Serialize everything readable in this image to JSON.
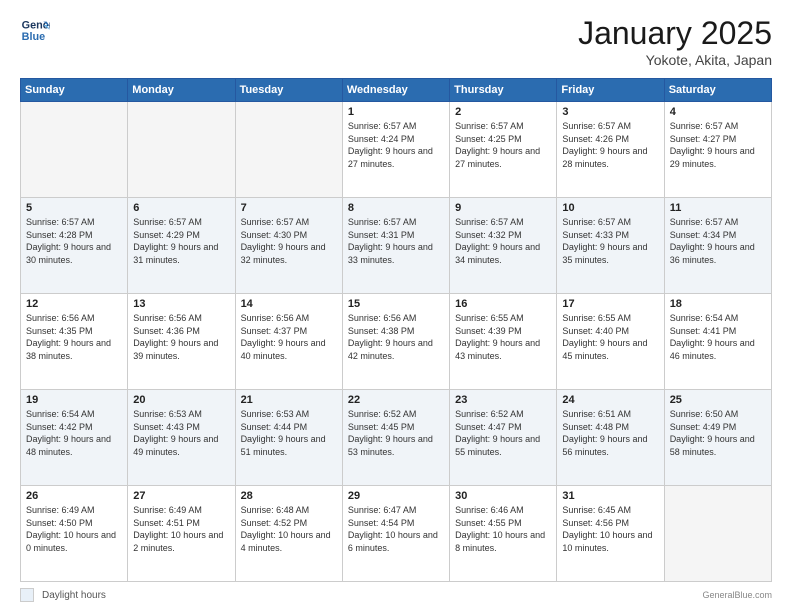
{
  "header": {
    "logo_line1": "General",
    "logo_line2": "Blue",
    "month": "January 2025",
    "location": "Yokote, Akita, Japan"
  },
  "days_of_week": [
    "Sunday",
    "Monday",
    "Tuesday",
    "Wednesday",
    "Thursday",
    "Friday",
    "Saturday"
  ],
  "weeks": [
    {
      "row_class": "row-white",
      "days": [
        {
          "num": "",
          "info": ""
        },
        {
          "num": "",
          "info": ""
        },
        {
          "num": "",
          "info": ""
        },
        {
          "num": "1",
          "info": "Sunrise: 6:57 AM\nSunset: 4:24 PM\nDaylight: 9 hours and 27 minutes."
        },
        {
          "num": "2",
          "info": "Sunrise: 6:57 AM\nSunset: 4:25 PM\nDaylight: 9 hours and 27 minutes."
        },
        {
          "num": "3",
          "info": "Sunrise: 6:57 AM\nSunset: 4:26 PM\nDaylight: 9 hours and 28 minutes."
        },
        {
          "num": "4",
          "info": "Sunrise: 6:57 AM\nSunset: 4:27 PM\nDaylight: 9 hours and 29 minutes."
        }
      ]
    },
    {
      "row_class": "row-blue",
      "days": [
        {
          "num": "5",
          "info": "Sunrise: 6:57 AM\nSunset: 4:28 PM\nDaylight: 9 hours and 30 minutes."
        },
        {
          "num": "6",
          "info": "Sunrise: 6:57 AM\nSunset: 4:29 PM\nDaylight: 9 hours and 31 minutes."
        },
        {
          "num": "7",
          "info": "Sunrise: 6:57 AM\nSunset: 4:30 PM\nDaylight: 9 hours and 32 minutes."
        },
        {
          "num": "8",
          "info": "Sunrise: 6:57 AM\nSunset: 4:31 PM\nDaylight: 9 hours and 33 minutes."
        },
        {
          "num": "9",
          "info": "Sunrise: 6:57 AM\nSunset: 4:32 PM\nDaylight: 9 hours and 34 minutes."
        },
        {
          "num": "10",
          "info": "Sunrise: 6:57 AM\nSunset: 4:33 PM\nDaylight: 9 hours and 35 minutes."
        },
        {
          "num": "11",
          "info": "Sunrise: 6:57 AM\nSunset: 4:34 PM\nDaylight: 9 hours and 36 minutes."
        }
      ]
    },
    {
      "row_class": "row-white",
      "days": [
        {
          "num": "12",
          "info": "Sunrise: 6:56 AM\nSunset: 4:35 PM\nDaylight: 9 hours and 38 minutes."
        },
        {
          "num": "13",
          "info": "Sunrise: 6:56 AM\nSunset: 4:36 PM\nDaylight: 9 hours and 39 minutes."
        },
        {
          "num": "14",
          "info": "Sunrise: 6:56 AM\nSunset: 4:37 PM\nDaylight: 9 hours and 40 minutes."
        },
        {
          "num": "15",
          "info": "Sunrise: 6:56 AM\nSunset: 4:38 PM\nDaylight: 9 hours and 42 minutes."
        },
        {
          "num": "16",
          "info": "Sunrise: 6:55 AM\nSunset: 4:39 PM\nDaylight: 9 hours and 43 minutes."
        },
        {
          "num": "17",
          "info": "Sunrise: 6:55 AM\nSunset: 4:40 PM\nDaylight: 9 hours and 45 minutes."
        },
        {
          "num": "18",
          "info": "Sunrise: 6:54 AM\nSunset: 4:41 PM\nDaylight: 9 hours and 46 minutes."
        }
      ]
    },
    {
      "row_class": "row-blue",
      "days": [
        {
          "num": "19",
          "info": "Sunrise: 6:54 AM\nSunset: 4:42 PM\nDaylight: 9 hours and 48 minutes."
        },
        {
          "num": "20",
          "info": "Sunrise: 6:53 AM\nSunset: 4:43 PM\nDaylight: 9 hours and 49 minutes."
        },
        {
          "num": "21",
          "info": "Sunrise: 6:53 AM\nSunset: 4:44 PM\nDaylight: 9 hours and 51 minutes."
        },
        {
          "num": "22",
          "info": "Sunrise: 6:52 AM\nSunset: 4:45 PM\nDaylight: 9 hours and 53 minutes."
        },
        {
          "num": "23",
          "info": "Sunrise: 6:52 AM\nSunset: 4:47 PM\nDaylight: 9 hours and 55 minutes."
        },
        {
          "num": "24",
          "info": "Sunrise: 6:51 AM\nSunset: 4:48 PM\nDaylight: 9 hours and 56 minutes."
        },
        {
          "num": "25",
          "info": "Sunrise: 6:50 AM\nSunset: 4:49 PM\nDaylight: 9 hours and 58 minutes."
        }
      ]
    },
    {
      "row_class": "row-white",
      "days": [
        {
          "num": "26",
          "info": "Sunrise: 6:49 AM\nSunset: 4:50 PM\nDaylight: 10 hours and 0 minutes."
        },
        {
          "num": "27",
          "info": "Sunrise: 6:49 AM\nSunset: 4:51 PM\nDaylight: 10 hours and 2 minutes."
        },
        {
          "num": "28",
          "info": "Sunrise: 6:48 AM\nSunset: 4:52 PM\nDaylight: 10 hours and 4 minutes."
        },
        {
          "num": "29",
          "info": "Sunrise: 6:47 AM\nSunset: 4:54 PM\nDaylight: 10 hours and 6 minutes."
        },
        {
          "num": "30",
          "info": "Sunrise: 6:46 AM\nSunset: 4:55 PM\nDaylight: 10 hours and 8 minutes."
        },
        {
          "num": "31",
          "info": "Sunrise: 6:45 AM\nSunset: 4:56 PM\nDaylight: 10 hours and 10 minutes."
        },
        {
          "num": "",
          "info": ""
        }
      ]
    }
  ],
  "footer": {
    "legend_label": "Daylight hours",
    "source": "GeneralBlue.com"
  }
}
